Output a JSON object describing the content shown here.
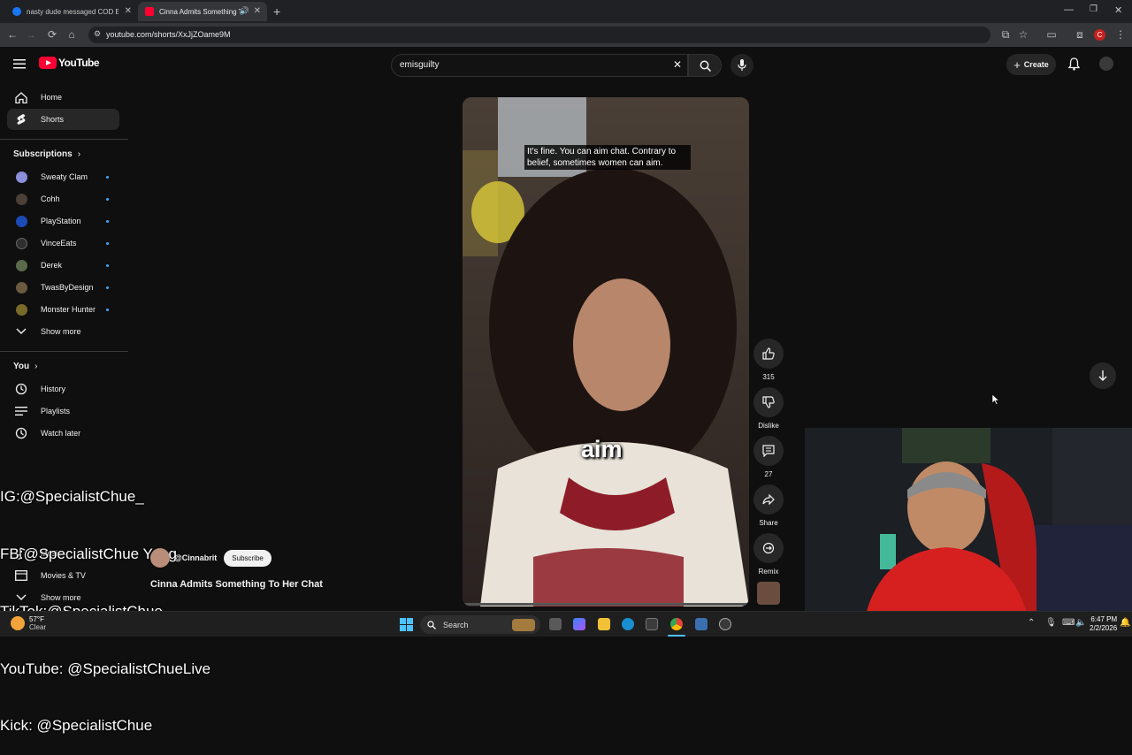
{
  "browser": {
    "tabs": [
      {
        "title": "nasty dude messaged COD BU",
        "active": false,
        "favicon_color": "#1877f2"
      },
      {
        "title": "Cinna Admits Something To",
        "active": true,
        "favicon_color": "#ff0033"
      }
    ],
    "url": "youtube.com/shorts/XxJjZOame9M",
    "profile_initial": "C"
  },
  "youtube": {
    "logo_text": "YouTube",
    "search_value": "emisguilty",
    "create_label": "Create"
  },
  "sidebar": {
    "main": [
      {
        "label": "Home",
        "icon": "home-icon",
        "active": false
      },
      {
        "label": "Shorts",
        "icon": "shorts-icon",
        "active": true
      }
    ],
    "subscriptions_heading": "Subscriptions",
    "subscriptions": [
      {
        "label": "Sweaty Clam",
        "avatar_color": "#8b8fd9"
      },
      {
        "label": "Cohh",
        "avatar_color": "#4d4036"
      },
      {
        "label": "PlayStation",
        "avatar_color": "#1c4bb7"
      },
      {
        "label": "VinceEats",
        "avatar_color": "#2f2f2f"
      },
      {
        "label": "Derek",
        "avatar_color": "#5a6b4a"
      },
      {
        "label": "TwasByDesign",
        "avatar_color": "#6b5a40"
      },
      {
        "label": "Monster Hunter",
        "avatar_color": "#7a6a2a"
      }
    ],
    "show_more_1": "Show more",
    "you_heading": "You",
    "you_items": [
      {
        "label": "History",
        "icon": "history-icon"
      },
      {
        "label": "Playlists",
        "icon": "playlists-icon"
      },
      {
        "label": "Watch later",
        "icon": "watch-later-icon"
      }
    ],
    "explore_items": [
      {
        "label": "Music",
        "icon": "music-icon"
      },
      {
        "label": "Movies & TV",
        "icon": "movies-icon"
      }
    ],
    "show_more_2": "Show more"
  },
  "overlay_lines": [
    "IG:@SpecialistChue_",
    "FB:@SpecialistChue Yang",
    "TikTok:@SpecialistChue",
    "YouTube: @SpecialistChueLive",
    "Kick: @SpecialistChue"
  ],
  "short": {
    "caption": "It's fine. You can aim chat. Contrary to belief, sometimes women can aim.",
    "subtitle_word": "aim",
    "channel": "@Cinnabrit",
    "subscribe_label": "Subscribe",
    "title": "Cinna Admits Something To Her Chat",
    "actions": {
      "like_count": "315",
      "dislike_label": "Dislike",
      "comment_count": "27",
      "share_label": "Share",
      "remix_label": "Remix"
    }
  },
  "taskbar": {
    "weather_temp": "57°F",
    "weather_desc": "Clear",
    "search_label": "Search",
    "time": "6:47 PM",
    "date": "2/2/2026"
  },
  "colors": {
    "accent_red": "#ff0033",
    "like_blue": "#3ea6ff",
    "background": "#0f0f0f"
  }
}
